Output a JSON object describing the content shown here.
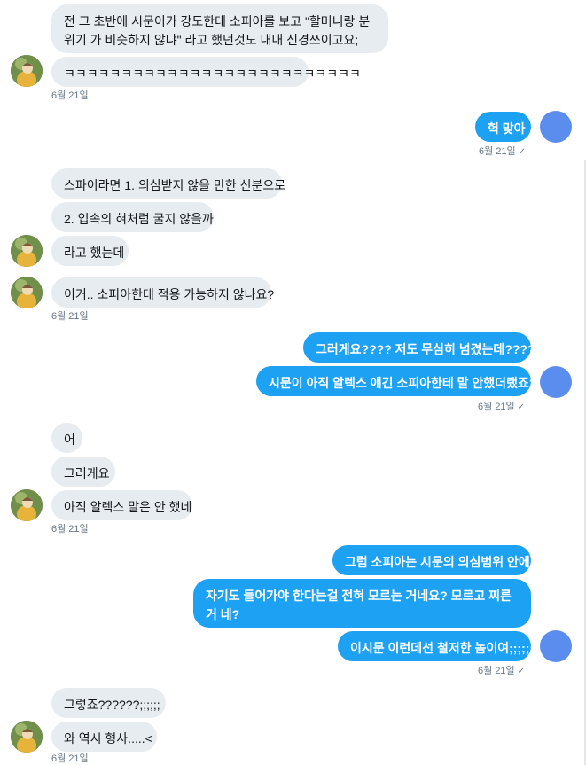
{
  "messages": {
    "m1": "전 그 초반에 시문이가 강도한테 소피아를 보고 \"할머니랑 분위기 가 비슷하지 않냐\" 라고 했던것도 내내 신경쓰이고요;",
    "m2": "ㅋㅋㅋㅋㅋㅋㅋㅋㅋㅋㅋㅋㅋㅋㅋㅋㅋㅋㅋㅋㅋㅋㅋㅋㅋㅋ",
    "m3": "헉 맞아",
    "m4": "스파이라면 1. 의심받지 않을 만한 신분으로",
    "m5": "2. 입속의 혀처럼 굴지 않을까",
    "m6": "라고 했는데",
    "m7": "이거.. 소피아한테 적용 가능하지 않나요?",
    "m8": "그러게요???? 저도 무심히 넘겼는데????",
    "m9": "시문이 아직 알렉스 얘긴 소피아한테 말 안했더랬죠?",
    "m10": "어",
    "m11": "그러게요",
    "m12": "아직 알렉스 말은 안 했네",
    "m13": "그럼 소피아는 시문의 의심범위 안에",
    "m14": "자기도 들어가야 한다는걸 전혀 모르는 거네요? 모르고 찌른거 네?",
    "m15": "이시문 이런데선 철저한 놈이여;;;;;;",
    "m16": "그렇죠??????;;;;;;",
    "m17": "와 역시 형사.....<"
  },
  "timestamp": "6월 21일",
  "read_mark": "✓",
  "colors": {
    "sent_bubble": "#1da1f2",
    "received_bubble": "#e6ecf0",
    "my_avatar": "#5b8def"
  },
  "icons": {
    "partner_avatar": "partner-avatar-icon",
    "my_avatar": "my-avatar-icon",
    "read": "checkmark-icon"
  }
}
